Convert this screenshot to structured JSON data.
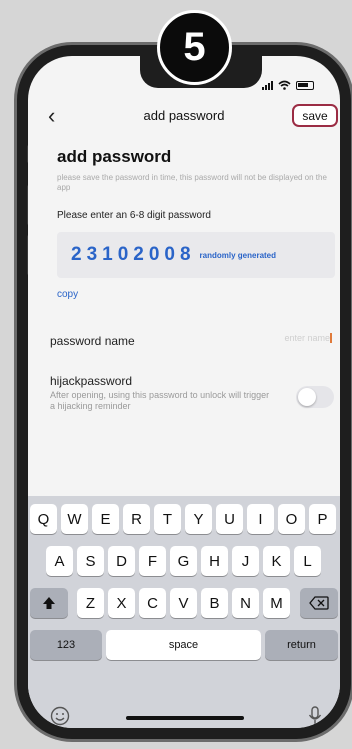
{
  "step_number": "5",
  "nav": {
    "back_icon": "chevron-left-icon",
    "title": "add password",
    "save_label": "save"
  },
  "heading": "add password",
  "hint": "please save the password in time, this password will not be displayed on the app",
  "prompt": "Please enter an 6-8 digit password",
  "password": {
    "digits": "23102008",
    "random_label": "randomly generated"
  },
  "copy_label": "copy",
  "password_name": {
    "label": "password name",
    "placeholder": "enter name"
  },
  "hijack": {
    "title": "hijackpassword",
    "description": "After opening, using this password to unlock will trigger a hijacking reminder",
    "enabled": false
  },
  "keyboard": {
    "row1": [
      "Q",
      "W",
      "E",
      "R",
      "T",
      "Y",
      "U",
      "I",
      "O",
      "P"
    ],
    "row2": [
      "A",
      "S",
      "D",
      "F",
      "G",
      "H",
      "J",
      "K",
      "L"
    ],
    "row3": [
      "Z",
      "X",
      "C",
      "V",
      "B",
      "N",
      "M"
    ],
    "shift_icon": "shift-icon",
    "backspace_icon": "backspace-icon",
    "numbers_label": "123",
    "space_label": "space",
    "return_label": "return",
    "emoji_icon": "emoji-icon",
    "mic_icon": "microphone-icon"
  },
  "colors": {
    "accent": "#2a64c8",
    "save_outline": "#9b2c44",
    "badge_bg": "#0b0b0b"
  }
}
